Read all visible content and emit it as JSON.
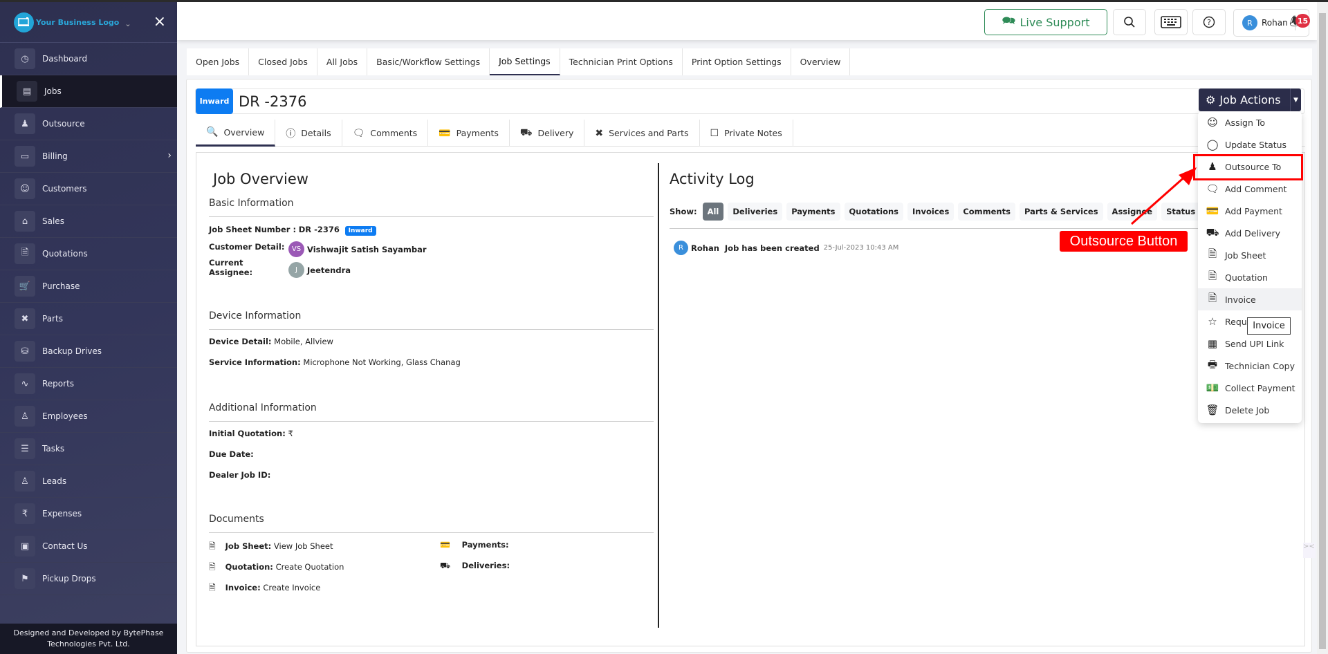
{
  "sidebar": {
    "logo_text": "Your Business Logo",
    "items": [
      {
        "label": "Dashboard",
        "icon": "dashboard-icon"
      },
      {
        "label": "Jobs",
        "icon": "ticket-icon",
        "active": true
      },
      {
        "label": "Outsource",
        "icon": "outsource-icon"
      },
      {
        "label": "Billing",
        "icon": "wallet-icon",
        "has_submenu": true
      },
      {
        "label": "Customers",
        "icon": "customers-icon"
      },
      {
        "label": "Sales",
        "icon": "store-icon"
      },
      {
        "label": "Quotations",
        "icon": "quotation-icon"
      },
      {
        "label": "Purchase",
        "icon": "cart-icon"
      },
      {
        "label": "Parts",
        "icon": "tools-icon"
      },
      {
        "label": "Backup Drives",
        "icon": "database-icon"
      },
      {
        "label": "Reports",
        "icon": "chart-icon"
      },
      {
        "label": "Employees",
        "icon": "employee-icon"
      },
      {
        "label": "Tasks",
        "icon": "tasks-icon"
      },
      {
        "label": "Leads",
        "icon": "user-plus-icon"
      },
      {
        "label": "Expenses",
        "icon": "rupee-icon"
      },
      {
        "label": "Contact Us",
        "icon": "contact-card-icon"
      },
      {
        "label": "Pickup Drops",
        "icon": "pickup-icon"
      }
    ],
    "footer": "Designed and Developed by BytePhase Technologies Pvt. Ltd."
  },
  "header": {
    "live_support": "Live Support",
    "user_initial": "R",
    "user_name": "Rohan",
    "notification_count": "15"
  },
  "main_tabs": [
    {
      "label": "Open Jobs"
    },
    {
      "label": "Closed Jobs"
    },
    {
      "label": "All Jobs"
    },
    {
      "label": "Basic/Workflow Settings"
    },
    {
      "label": "Job Settings",
      "active": true
    },
    {
      "label": "Technician Print Options"
    },
    {
      "label": "Print Option Settings"
    },
    {
      "label": "Overview"
    }
  ],
  "job": {
    "type_badge": "Inward",
    "number": "DR -2376",
    "actions_label": "Job Actions"
  },
  "sub_tabs": [
    {
      "label": "Overview",
      "icon": "overview-icon",
      "active": true
    },
    {
      "label": "Details",
      "icon": "info-icon"
    },
    {
      "label": "Comments",
      "icon": "comment-icon"
    },
    {
      "label": "Payments",
      "icon": "card-icon"
    },
    {
      "label": "Delivery",
      "icon": "truck-icon"
    },
    {
      "label": "Services and Parts",
      "icon": "tools-icon"
    },
    {
      "label": "Private Notes",
      "icon": "note-icon"
    }
  ],
  "overview": {
    "title": "Job Overview",
    "basic": {
      "heading": "Basic Information",
      "job_sheet_label": "Job Sheet Number :",
      "job_sheet_value": "DR -2376",
      "job_sheet_badge": "Inward",
      "customer_label": "Customer Detail:",
      "customer_initials": "VS",
      "customer_name": "Vishwajit Satish Sayambar",
      "assignee_label": "Current Assignee:",
      "assignee_initials": "J",
      "assignee_name": "Jeetendra"
    },
    "device": {
      "heading": "Device Information",
      "device_label": "Device Detail:",
      "device_value": "Mobile, Allview",
      "service_label": "Service Information:",
      "service_value": "Microphone Not Working, Glass Chanag"
    },
    "additional": {
      "heading": "Additional Information",
      "quotation_label": "Initial Quotation:",
      "quotation_value": "₹",
      "due_label": "Due Date:",
      "dealer_label": "Dealer Job ID:"
    },
    "documents": {
      "heading": "Documents",
      "job_sheet_label": "Job Sheet:",
      "job_sheet_link": "View Job Sheet",
      "quotation_label": "Quotation:",
      "quotation_link": "Create Quotation",
      "invoice_label": "Invoice:",
      "invoice_link": "Create Invoice",
      "payments_label": "Payments:",
      "deliveries_label": "Deliveries:"
    }
  },
  "activity": {
    "title": "Activity Log",
    "show_label": "Show:",
    "filters": [
      "All",
      "Deliveries",
      "Payments",
      "Quotations",
      "Invoices",
      "Comments",
      "Parts & Services",
      "Assignee",
      "Status"
    ],
    "entries": [
      {
        "initial": "R",
        "user": "Rohan",
        "text": "Job has been created",
        "time": "25-Jul-2023 10:43 AM"
      }
    ]
  },
  "job_actions_menu": [
    {
      "label": "Assign To",
      "icon": "users-icon"
    },
    {
      "label": "Update Status",
      "icon": "circle-icon"
    },
    {
      "label": "Outsource To",
      "icon": "outsource-icon"
    },
    {
      "label": "Add Comment",
      "icon": "comment-icon"
    },
    {
      "label": "Add Payment",
      "icon": "card-icon"
    },
    {
      "label": "Add Delivery",
      "icon": "truck-icon"
    },
    {
      "label": "Job Sheet",
      "icon": "file-icon"
    },
    {
      "label": "Quotation",
      "icon": "quotation-icon"
    },
    {
      "label": "Invoice",
      "icon": "invoice-icon"
    },
    {
      "label": "Reque",
      "icon": "star-icon"
    },
    {
      "label": "Send UPI Link",
      "icon": "qr-icon"
    },
    {
      "label": "Technician Copy",
      "icon": "printer-icon"
    },
    {
      "label": "Collect Payment",
      "icon": "cash-icon"
    },
    {
      "label": "Delete Job",
      "icon": "trash-icon"
    }
  ],
  "tooltip": "Invoice",
  "annotation": {
    "label": "Outsource Button",
    "color": "#ff0000"
  }
}
